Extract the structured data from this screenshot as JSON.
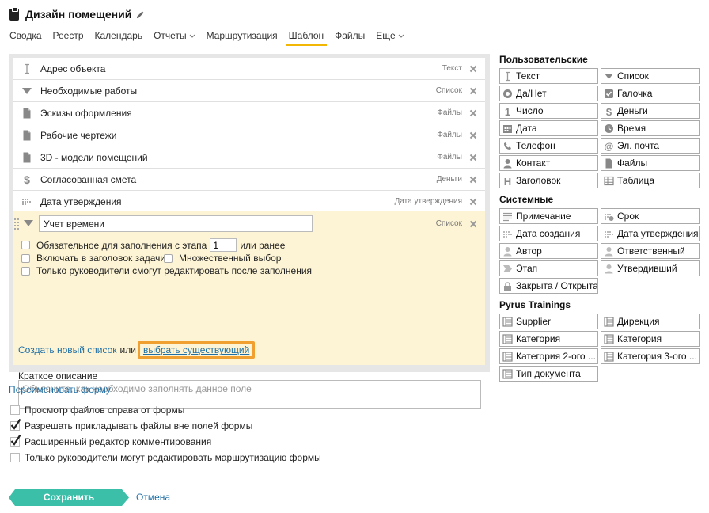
{
  "header": {
    "title": "Дизайн помещений"
  },
  "tabs": [
    {
      "label": "Сводка"
    },
    {
      "label": "Реестр"
    },
    {
      "label": "Календарь"
    },
    {
      "label": "Отчеты"
    },
    {
      "label": "Маршрутизация"
    },
    {
      "label": "Шаблон"
    },
    {
      "label": "Файлы"
    },
    {
      "label": "Еще"
    }
  ],
  "fields": [
    {
      "name": "Адрес объекта",
      "type": "Текст",
      "icon": "text-cursor-icon"
    },
    {
      "name": "Необходимые работы",
      "type": "Список",
      "icon": "triangle-down-icon"
    },
    {
      "name": "Эскизы оформления",
      "type": "Файлы",
      "icon": "file-icon"
    },
    {
      "name": "Рабочие чертежи",
      "type": "Файлы",
      "icon": "file-icon"
    },
    {
      "name": "3D - модели помещений",
      "type": "Файлы",
      "icon": "file-icon"
    },
    {
      "name": "Согласованная смета",
      "type": "Деньги",
      "icon": "dollar-icon"
    },
    {
      "name": "Дата утверждения",
      "type": "Дата утверждения",
      "icon": "date-dots-icon"
    }
  ],
  "edit": {
    "name_value": "Учет времени",
    "type": "Список",
    "required_prefix": "Обязательное для заполнения с этапа",
    "stage_value": "1",
    "required_suffix": "или ранее",
    "include_header": "Включать в заголовок задачи",
    "multi_select": "Множественный выбор",
    "managers_only": "Только руководители смогут редактировать после заполнения",
    "create_list": "Создать новый список",
    "or": "или",
    "pick_existing": "выбрать существующий",
    "desc_label": "Краткое описание",
    "desc_placeholder": "Объясните, как необходимо заполнять данное поле"
  },
  "palette": {
    "custom_title": "Пользовательские",
    "custom": [
      {
        "label": "Текст",
        "icon": "text-cursor-icon"
      },
      {
        "label": "Список",
        "icon": "triangle-down-icon"
      },
      {
        "label": "Да/Нет",
        "icon": "yes-no-icon"
      },
      {
        "label": "Галочка",
        "icon": "checkbox-icon"
      },
      {
        "label": "Число",
        "icon": "number-icon"
      },
      {
        "label": "Деньги",
        "icon": "dollar-icon"
      },
      {
        "label": "Дата",
        "icon": "calendar-icon"
      },
      {
        "label": "Время",
        "icon": "clock-icon"
      },
      {
        "label": "Телефон",
        "icon": "phone-icon"
      },
      {
        "label": "Эл. почта",
        "icon": "at-icon"
      },
      {
        "label": "Контакт",
        "icon": "person-icon"
      },
      {
        "label": "Файлы",
        "icon": "file-icon"
      },
      {
        "label": "Заголовок",
        "icon": "heading-icon"
      },
      {
        "label": "Таблица",
        "icon": "table-icon"
      }
    ],
    "system_title": "Системные",
    "system": [
      {
        "label": "Примечание",
        "icon": "lines-icon"
      },
      {
        "label": "Срок",
        "icon": "deadline-icon"
      },
      {
        "label": "Дата создания",
        "icon": "date-dots-icon"
      },
      {
        "label": "Дата утверждения",
        "icon": "date-dots-icon"
      },
      {
        "label": "Автор",
        "icon": "author-icon"
      },
      {
        "label": "Ответственный",
        "icon": "responsible-icon"
      },
      {
        "label": "Этап",
        "icon": "stage-icon"
      },
      {
        "label": "Утвердивший",
        "icon": "approver-icon"
      },
      {
        "label": "Закрыта / Открыта",
        "icon": "lock-icon"
      }
    ],
    "trainings_title": "Pyrus Trainings",
    "trainings": [
      {
        "label": "Supplier",
        "icon": "catalog-icon"
      },
      {
        "label": "Дирекция",
        "icon": "catalog-icon"
      },
      {
        "label": "Категория",
        "icon": "catalog-icon"
      },
      {
        "label": "Категория",
        "icon": "catalog-icon"
      },
      {
        "label": "Категория 2-ого ...",
        "icon": "catalog-icon"
      },
      {
        "label": "Категория 3-ого ...",
        "icon": "catalog-icon"
      },
      {
        "label": "Тип документа",
        "icon": "catalog-icon"
      }
    ]
  },
  "bottom": {
    "rename": "Переименовать форму",
    "options": [
      {
        "label": "Просмотр файлов справа от формы",
        "checked": false
      },
      {
        "label": "Разрешать прикладывать файлы вне полей формы",
        "checked": true
      },
      {
        "label": "Расширенный редактор комментирования",
        "checked": true
      },
      {
        "label": "Только руководители могут редактировать маршрутизацию формы",
        "checked": false
      }
    ],
    "save": "Сохранить",
    "cancel": "Отмена"
  },
  "colors": {
    "accent_tab": "#f2b705",
    "save_button": "#3bbfa8",
    "link": "#1f6fa5",
    "edit_bg": "#fdf4d5",
    "highlight": "#f0a030"
  }
}
